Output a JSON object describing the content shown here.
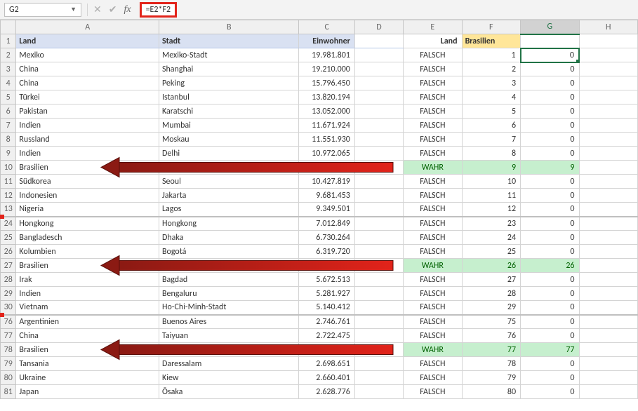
{
  "formula_bar": {
    "cell_ref": "G2",
    "formula": "=E2*F2"
  },
  "headers": {
    "land": "Land",
    "stadt": "Stadt",
    "einwohner": "Einwohner",
    "land_e": "Land",
    "bras": "Brasilien"
  },
  "cols": [
    "A",
    "B",
    "C",
    "D",
    "E",
    "F",
    "G",
    "H"
  ],
  "rows": [
    {
      "n": 2,
      "land": "Mexiko",
      "stadt": "Mexiko-Stadt",
      "ein": "19.981.801",
      "e": "FALSCH",
      "f": "1",
      "g": "0"
    },
    {
      "n": 3,
      "land": "China",
      "stadt": "Shanghai",
      "ein": "19.210.000",
      "e": "FALSCH",
      "f": "2",
      "g": "0"
    },
    {
      "n": 4,
      "land": "China",
      "stadt": "Peking",
      "ein": "15.796.450",
      "e": "FALSCH",
      "f": "3",
      "g": "0"
    },
    {
      "n": 5,
      "land": "Türkei",
      "stadt": "Istanbul",
      "ein": "13.820.194",
      "e": "FALSCH",
      "f": "4",
      "g": "0"
    },
    {
      "n": 6,
      "land": "Pakistan",
      "stadt": "Karatschi",
      "ein": "13.052.000",
      "e": "FALSCH",
      "f": "5",
      "g": "0"
    },
    {
      "n": 7,
      "land": "Indien",
      "stadt": "Mumbai",
      "ein": "11.671.924",
      "e": "FALSCH",
      "f": "6",
      "g": "0"
    },
    {
      "n": 8,
      "land": "Russland",
      "stadt": "Moskau",
      "ein": "11.551.930",
      "e": "FALSCH",
      "f": "7",
      "g": "0"
    },
    {
      "n": 9,
      "land": "Indien",
      "stadt": "Delhi",
      "ein": "10.972.065",
      "e": "FALSCH",
      "f": "8",
      "g": "0"
    },
    {
      "n": 10,
      "land": "Brasilien",
      "stadt": "",
      "ein": "",
      "e": "WAHR",
      "f": "9",
      "g": "9",
      "wahr": true,
      "arrow": true
    },
    {
      "n": 11,
      "land": "Südkorea",
      "stadt": "Seoul",
      "ein": "10.427.819",
      "e": "FALSCH",
      "f": "10",
      "g": "0"
    },
    {
      "n": 12,
      "land": "Indonesien",
      "stadt": "Jakarta",
      "ein": "9.681.453",
      "e": "FALSCH",
      "f": "11",
      "g": "0"
    },
    {
      "n": 13,
      "land": "Nigeria",
      "stadt": "Lagos",
      "ein": "9.349.501",
      "e": "FALSCH",
      "f": "12",
      "g": "0",
      "break": true,
      "redleft": true
    },
    {
      "n": 24,
      "land": "Hongkong",
      "stadt": "Hongkong",
      "ein": "7.012.849",
      "e": "FALSCH",
      "f": "23",
      "g": "0"
    },
    {
      "n": 25,
      "land": "Bangladesch",
      "stadt": "Dhaka",
      "ein": "6.730.264",
      "e": "FALSCH",
      "f": "24",
      "g": "0"
    },
    {
      "n": 26,
      "land": "Kolumbien",
      "stadt": "Bogotá",
      "ein": "6.319.720",
      "e": "FALSCH",
      "f": "25",
      "g": "0"
    },
    {
      "n": 27,
      "land": "Brasilien",
      "stadt": "",
      "ein": "",
      "e": "WAHR",
      "f": "26",
      "g": "26",
      "wahr": true,
      "arrow": true
    },
    {
      "n": 28,
      "land": "Irak",
      "stadt": "Bagdad",
      "ein": "5.672.513",
      "e": "FALSCH",
      "f": "27",
      "g": "0"
    },
    {
      "n": 29,
      "land": "Indien",
      "stadt": "Bengaluru",
      "ein": "5.281.927",
      "e": "FALSCH",
      "f": "28",
      "g": "0"
    },
    {
      "n": 30,
      "land": "Vietnam",
      "stadt": "Ho-Chi-Minh-Stadt",
      "ein": "5.140.412",
      "e": "FALSCH",
      "f": "29",
      "g": "0",
      "break": true,
      "redleft": true
    },
    {
      "n": 76,
      "land": "Argentinien",
      "stadt": "Buenos Aires",
      "ein": "2.746.761",
      "e": "FALSCH",
      "f": "75",
      "g": "0"
    },
    {
      "n": 77,
      "land": "China",
      "stadt": "Taiyuan",
      "ein": "2.722.475",
      "e": "FALSCH",
      "f": "76",
      "g": "0"
    },
    {
      "n": 78,
      "land": "Brasilien",
      "stadt": "",
      "ein": "",
      "e": "WAHR",
      "f": "77",
      "g": "77",
      "wahr": true,
      "arrow": true
    },
    {
      "n": 79,
      "land": "Tansania",
      "stadt": "Daressalam",
      "ein": "2.698.651",
      "e": "FALSCH",
      "f": "78",
      "g": "0"
    },
    {
      "n": 80,
      "land": "Ukraine",
      "stadt": "Kiew",
      "ein": "2.660.401",
      "e": "FALSCH",
      "f": "79",
      "g": "0"
    },
    {
      "n": 81,
      "land": "Japan",
      "stadt": "Ōsaka",
      "ein": "2.628.776",
      "e": "FALSCH",
      "f": "80",
      "g": "0"
    }
  ]
}
